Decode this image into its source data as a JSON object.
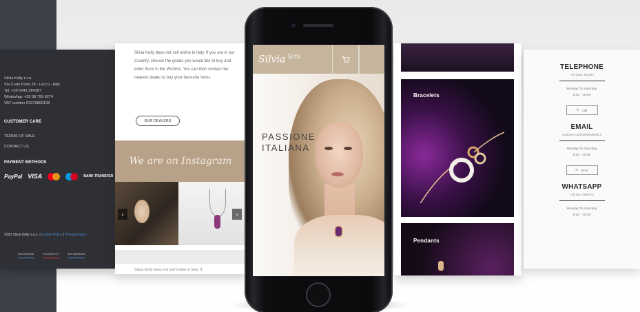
{
  "footer": {
    "address_lines": [
      "Silvia Kelly s.r.o.",
      "Via Corte Porta 25 - Lecco - Italy",
      "Tel. +39 0341 284387",
      "WhatsApp: +39 58 799 8274",
      "VAT number 03370800108"
    ],
    "customer_care_heading": "CUSTOMER CARE",
    "links": [
      "TERMS OF SALE",
      "CONTACT US"
    ],
    "payment_heading": "PAYMENT METHODS",
    "payment_methods": [
      "PayPal",
      "VISA",
      "mastercard",
      "maestro",
      "BANK TRANSFER"
    ],
    "copyright_prefix": "2020 Silvia Kelly s.a.s. | ",
    "cookie_policy": "Cookie Policy",
    "separator": " | ",
    "privacy_policy": "Privacy Policy",
    "social": [
      "FACEBOOK",
      "PINTEREST",
      "INSTAGRAM"
    ],
    "colors": {
      "mastercard_red": "#eb001b",
      "mastercard_yellow": "#f79e1b",
      "maestro_blue": "#0099df",
      "maestro_red": "#e5001c"
    }
  },
  "dealers": {
    "text": "Silvia Kelly does not sell online in Italy. If you are in our Country, choose the goods you would like to buy and enter them in the Wishlist. You can then contact the nearest dealer to buy your favourite items.",
    "button_label": "OUR DEALERS",
    "instagram_banner": "We are on Instagram",
    "arrow_prev": "‹",
    "arrow_next": "›",
    "footer_text": "Silvia Kelly does not sell online in Italy. If"
  },
  "phone": {
    "logo_text": "Silvia",
    "logo_badge": "50th",
    "cart_icon": "cart-icon",
    "menu_icon": "hamburger-icon",
    "hero_title_line1": "PASSIONE",
    "hero_title_line2": "ITALIANA",
    "brand_color": "#c5b59d"
  },
  "jewelry": {
    "categories": [
      "Bracelets",
      "Pendants"
    ]
  },
  "contact": {
    "telephone_heading": "TELEPHONE",
    "telephone_value": "+39 0341 284387",
    "telephone_hours_days": "Monday To Saturday",
    "telephone_hours_time": "8:30 - 18:00",
    "call_button": "Call",
    "email_heading": "EMAIL",
    "email_value": "customer.care(at)silviakelly.it",
    "email_hours_days": "Monday To Saturday",
    "email_hours_time": "8:30 - 18:00",
    "write_button": "Write",
    "whatsapp_heading": "WHATSAPP",
    "whatsapp_value": "+39 351 7999274",
    "whatsapp_hours_days": "Monday To Saturday",
    "whatsapp_hours_time": "8:30 - 18:00"
  }
}
